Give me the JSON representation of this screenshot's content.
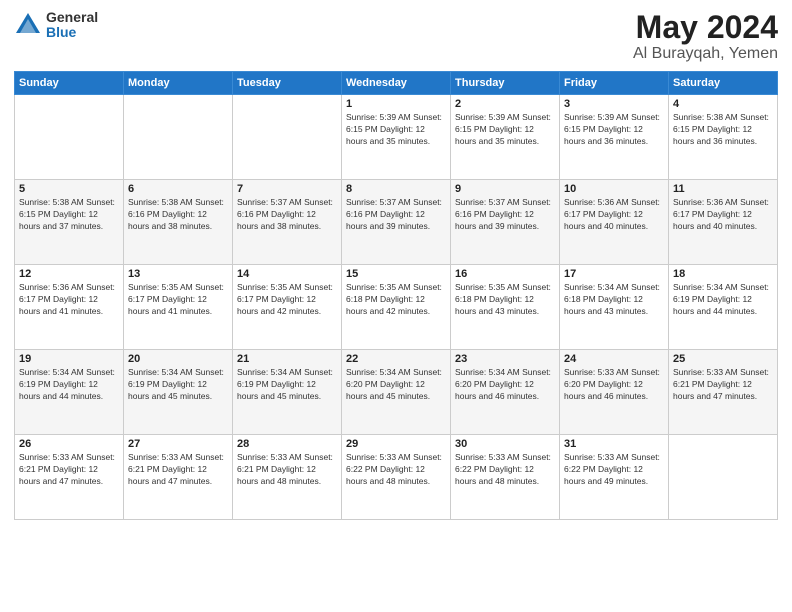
{
  "logo": {
    "general": "General",
    "blue": "Blue"
  },
  "title": {
    "month_year": "May 2024",
    "location": "Al Burayqah, Yemen"
  },
  "weekdays": [
    "Sunday",
    "Monday",
    "Tuesday",
    "Wednesday",
    "Thursday",
    "Friday",
    "Saturday"
  ],
  "weeks": [
    [
      {
        "day": "",
        "info": ""
      },
      {
        "day": "",
        "info": ""
      },
      {
        "day": "",
        "info": ""
      },
      {
        "day": "1",
        "info": "Sunrise: 5:39 AM\nSunset: 6:15 PM\nDaylight: 12 hours\nand 35 minutes."
      },
      {
        "day": "2",
        "info": "Sunrise: 5:39 AM\nSunset: 6:15 PM\nDaylight: 12 hours\nand 35 minutes."
      },
      {
        "day": "3",
        "info": "Sunrise: 5:39 AM\nSunset: 6:15 PM\nDaylight: 12 hours\nand 36 minutes."
      },
      {
        "day": "4",
        "info": "Sunrise: 5:38 AM\nSunset: 6:15 PM\nDaylight: 12 hours\nand 36 minutes."
      }
    ],
    [
      {
        "day": "5",
        "info": "Sunrise: 5:38 AM\nSunset: 6:15 PM\nDaylight: 12 hours\nand 37 minutes."
      },
      {
        "day": "6",
        "info": "Sunrise: 5:38 AM\nSunset: 6:16 PM\nDaylight: 12 hours\nand 38 minutes."
      },
      {
        "day": "7",
        "info": "Sunrise: 5:37 AM\nSunset: 6:16 PM\nDaylight: 12 hours\nand 38 minutes."
      },
      {
        "day": "8",
        "info": "Sunrise: 5:37 AM\nSunset: 6:16 PM\nDaylight: 12 hours\nand 39 minutes."
      },
      {
        "day": "9",
        "info": "Sunrise: 5:37 AM\nSunset: 6:16 PM\nDaylight: 12 hours\nand 39 minutes."
      },
      {
        "day": "10",
        "info": "Sunrise: 5:36 AM\nSunset: 6:17 PM\nDaylight: 12 hours\nand 40 minutes."
      },
      {
        "day": "11",
        "info": "Sunrise: 5:36 AM\nSunset: 6:17 PM\nDaylight: 12 hours\nand 40 minutes."
      }
    ],
    [
      {
        "day": "12",
        "info": "Sunrise: 5:36 AM\nSunset: 6:17 PM\nDaylight: 12 hours\nand 41 minutes."
      },
      {
        "day": "13",
        "info": "Sunrise: 5:35 AM\nSunset: 6:17 PM\nDaylight: 12 hours\nand 41 minutes."
      },
      {
        "day": "14",
        "info": "Sunrise: 5:35 AM\nSunset: 6:17 PM\nDaylight: 12 hours\nand 42 minutes."
      },
      {
        "day": "15",
        "info": "Sunrise: 5:35 AM\nSunset: 6:18 PM\nDaylight: 12 hours\nand 42 minutes."
      },
      {
        "day": "16",
        "info": "Sunrise: 5:35 AM\nSunset: 6:18 PM\nDaylight: 12 hours\nand 43 minutes."
      },
      {
        "day": "17",
        "info": "Sunrise: 5:34 AM\nSunset: 6:18 PM\nDaylight: 12 hours\nand 43 minutes."
      },
      {
        "day": "18",
        "info": "Sunrise: 5:34 AM\nSunset: 6:19 PM\nDaylight: 12 hours\nand 44 minutes."
      }
    ],
    [
      {
        "day": "19",
        "info": "Sunrise: 5:34 AM\nSunset: 6:19 PM\nDaylight: 12 hours\nand 44 minutes."
      },
      {
        "day": "20",
        "info": "Sunrise: 5:34 AM\nSunset: 6:19 PM\nDaylight: 12 hours\nand 45 minutes."
      },
      {
        "day": "21",
        "info": "Sunrise: 5:34 AM\nSunset: 6:19 PM\nDaylight: 12 hours\nand 45 minutes."
      },
      {
        "day": "22",
        "info": "Sunrise: 5:34 AM\nSunset: 6:20 PM\nDaylight: 12 hours\nand 45 minutes."
      },
      {
        "day": "23",
        "info": "Sunrise: 5:34 AM\nSunset: 6:20 PM\nDaylight: 12 hours\nand 46 minutes."
      },
      {
        "day": "24",
        "info": "Sunrise: 5:33 AM\nSunset: 6:20 PM\nDaylight: 12 hours\nand 46 minutes."
      },
      {
        "day": "25",
        "info": "Sunrise: 5:33 AM\nSunset: 6:21 PM\nDaylight: 12 hours\nand 47 minutes."
      }
    ],
    [
      {
        "day": "26",
        "info": "Sunrise: 5:33 AM\nSunset: 6:21 PM\nDaylight: 12 hours\nand 47 minutes."
      },
      {
        "day": "27",
        "info": "Sunrise: 5:33 AM\nSunset: 6:21 PM\nDaylight: 12 hours\nand 47 minutes."
      },
      {
        "day": "28",
        "info": "Sunrise: 5:33 AM\nSunset: 6:21 PM\nDaylight: 12 hours\nand 48 minutes."
      },
      {
        "day": "29",
        "info": "Sunrise: 5:33 AM\nSunset: 6:22 PM\nDaylight: 12 hours\nand 48 minutes."
      },
      {
        "day": "30",
        "info": "Sunrise: 5:33 AM\nSunset: 6:22 PM\nDaylight: 12 hours\nand 48 minutes."
      },
      {
        "day": "31",
        "info": "Sunrise: 5:33 AM\nSunset: 6:22 PM\nDaylight: 12 hours\nand 49 minutes."
      },
      {
        "day": "",
        "info": ""
      }
    ]
  ]
}
